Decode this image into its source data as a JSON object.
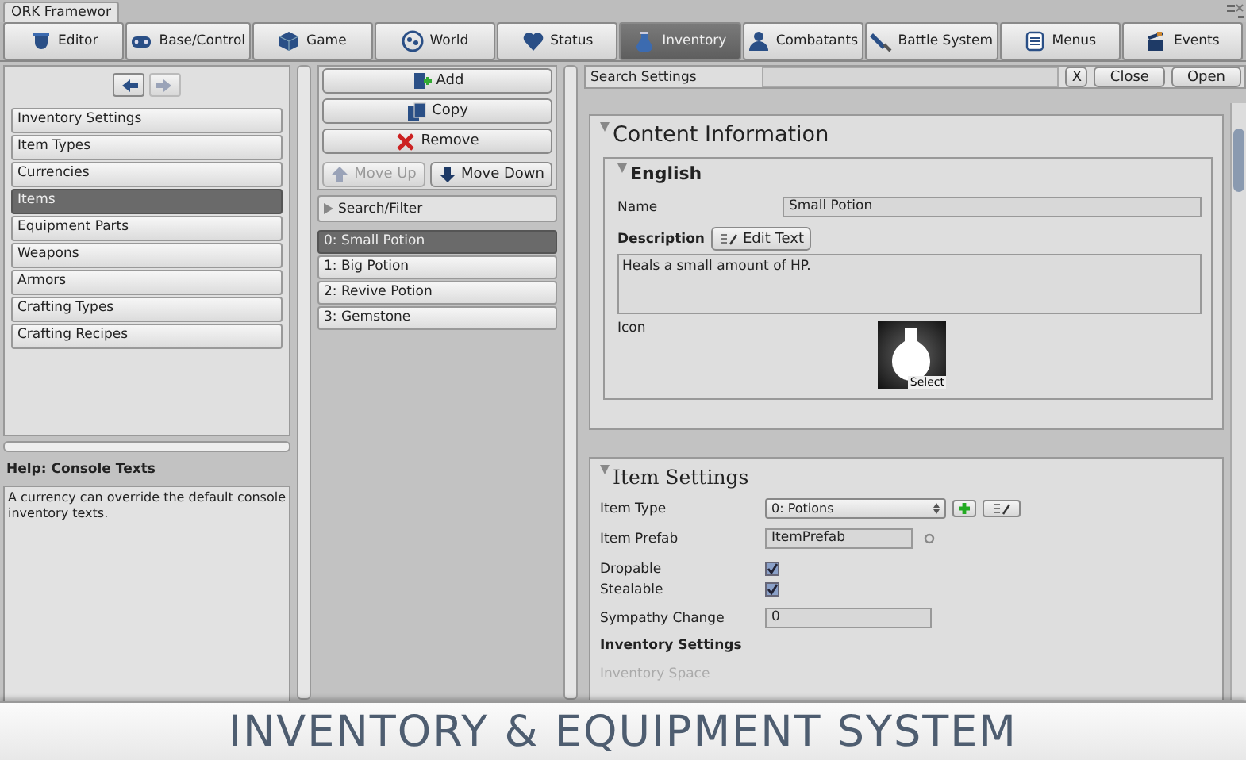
{
  "window": {
    "tab_title": "ORK Framewor"
  },
  "toolbar_tabs": [
    {
      "label": "Editor",
      "selected": false
    },
    {
      "label": "Base/Control",
      "selected": false
    },
    {
      "label": "Game",
      "selected": false
    },
    {
      "label": "World",
      "selected": false
    },
    {
      "label": "Status",
      "selected": false
    },
    {
      "label": "Inventory",
      "selected": true
    },
    {
      "label": "Combatants",
      "selected": false
    },
    {
      "label": "Battle System",
      "selected": false
    },
    {
      "label": "Menus",
      "selected": false
    },
    {
      "label": "Events",
      "selected": false
    }
  ],
  "sidebar": {
    "back_disabled": false,
    "forward_disabled": true,
    "items": [
      {
        "label": "Inventory Settings",
        "selected": false
      },
      {
        "label": "Item Types",
        "selected": false
      },
      {
        "label": "Currencies",
        "selected": false
      },
      {
        "label": "Items",
        "selected": true
      },
      {
        "label": "Equipment Parts",
        "selected": false
      },
      {
        "label": "Weapons",
        "selected": false
      },
      {
        "label": "Armors",
        "selected": false
      },
      {
        "label": "Crafting Types",
        "selected": false
      },
      {
        "label": "Crafting Recipes",
        "selected": false
      }
    ],
    "help_title": "Help: Console Texts",
    "help_text": "A currency can override the default console inventory texts."
  },
  "item_list": {
    "actions": [
      {
        "label": "Add",
        "kind": "add"
      },
      {
        "label": "Copy",
        "kind": "copy"
      },
      {
        "label": "Remove",
        "kind": "remove"
      }
    ],
    "move_buttons": [
      {
        "label": "Move Up",
        "kind": "up",
        "disabled": true
      },
      {
        "label": "Move Down",
        "kind": "down",
        "disabled": false
      }
    ],
    "filter": "Search/Filter",
    "items": [
      {
        "label": "0: Small Potion",
        "selected": true
      },
      {
        "label": "1: Big Potion",
        "selected": false
      },
      {
        "label": "2: Revive Potion",
        "selected": false
      },
      {
        "label": "3: Gemstone",
        "selected": false
      }
    ]
  },
  "search": {
    "label": "Search Settings",
    "clear": "X",
    "buttons": [
      "Close",
      "Open"
    ]
  },
  "content_information": {
    "title": "Content Information",
    "language": "English",
    "name_label": "Name",
    "name_value": "Small Potion",
    "description_label": "Description",
    "edit_button": "Edit Text",
    "description_value": "Heals a small amount of HP.",
    "icon_label": "Icon",
    "icon_button": "Select"
  },
  "item_settings": {
    "title": "Item Settings",
    "fields": [
      {
        "kind": "dropdown",
        "label": "Item Type",
        "value": "0: Potions"
      },
      {
        "kind": "text",
        "label": "Item Prefab",
        "value": "ItemPrefab"
      },
      {
        "kind": "checkbox",
        "label": "Dropable",
        "checked": true
      },
      {
        "kind": "checkbox",
        "label": "Stealable",
        "checked": true
      },
      {
        "kind": "number",
        "label": "Sympathy Change",
        "value": "0"
      }
    ],
    "subheading": "Inventory Settings",
    "next_label": "Inventory Space"
  },
  "banner": {
    "text": "INVENTORY & EQUIPMENT SYSTEM"
  }
}
